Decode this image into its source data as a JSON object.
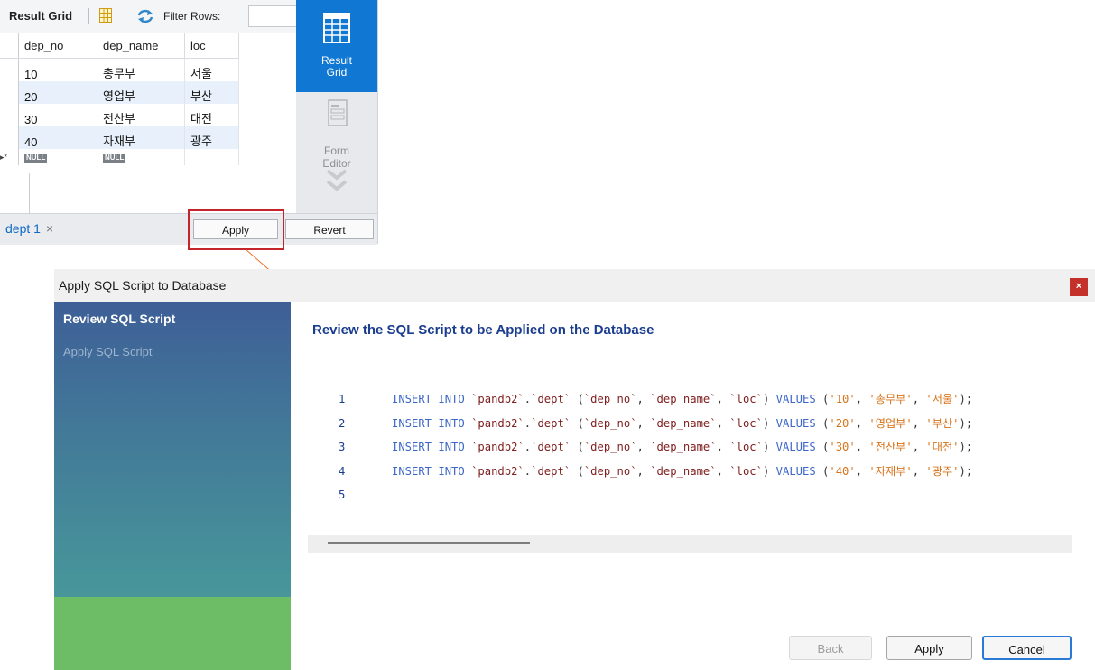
{
  "result_grid": {
    "toolbar": {
      "title": "Result Grid",
      "filter_label": "Filter Rows:",
      "filter_value": ""
    },
    "columns": [
      "dep_no",
      "dep_name",
      "loc"
    ],
    "rows": [
      [
        "10",
        "총무부",
        "서울"
      ],
      [
        "20",
        "영업부",
        "부산"
      ],
      [
        "30",
        "전산부",
        "대전"
      ],
      [
        "40",
        "자재부",
        "광주"
      ]
    ],
    "new_row": {
      "indicator": "▸*",
      "null_label": "NULL"
    },
    "side_panel": {
      "result_grid_label_1": "Result",
      "result_grid_label_2": "Grid",
      "form_editor_label_1": "Form",
      "form_editor_label_2": "Editor"
    },
    "footer": {
      "tab_label": "dept 1",
      "tab_close": "×",
      "apply_label": "Apply",
      "revert_label": "Revert"
    }
  },
  "dialog": {
    "title": "Apply SQL Script to Database",
    "close_label": "×",
    "steps": [
      {
        "label": "Review SQL Script",
        "active": true
      },
      {
        "label": "Apply SQL Script",
        "active": false
      }
    ],
    "heading": "Review the SQL Script to be Applied on the Database",
    "script_lines": [
      {
        "num": "1",
        "values": [
          "'10'",
          "'총무부'",
          "'서울'"
        ]
      },
      {
        "num": "2",
        "values": [
          "'20'",
          "'영업부'",
          "'부산'"
        ]
      },
      {
        "num": "3",
        "values": [
          "'30'",
          "'전산부'",
          "'대전'"
        ]
      },
      {
        "num": "4",
        "values": [
          "'40'",
          "'자재부'",
          "'광주'"
        ]
      },
      {
        "num": "5",
        "values": []
      }
    ],
    "sql": {
      "insert": "INSERT INTO",
      "schema": "`pandb2`",
      "dot": ".",
      "table": "`dept`",
      "col_open": "(",
      "cols": [
        "`dep_no`",
        "`dep_name`",
        "`loc`"
      ],
      "col_close": ")",
      "values_kw": "VALUES",
      "end": ");"
    },
    "buttons": {
      "back": "Back",
      "apply": "Apply",
      "cancel": "Cancel"
    }
  },
  "colors": {
    "accent": "#1077d3",
    "highlight": "#c4242a",
    "step_done": "#6dbd66",
    "close_button": "#c4312b"
  }
}
